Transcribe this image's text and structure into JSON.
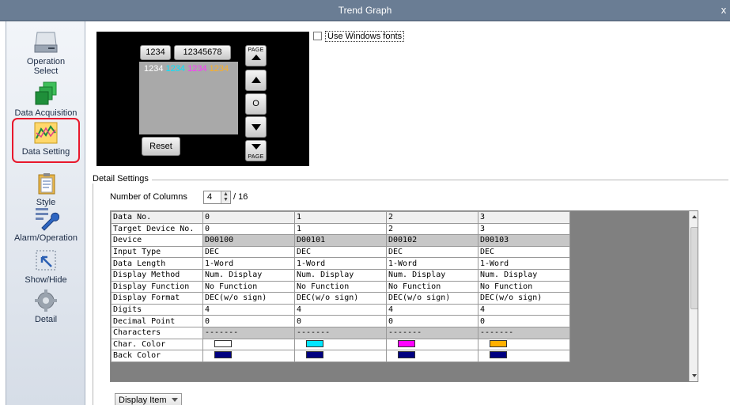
{
  "window": {
    "title": "Trend Graph",
    "close_glyph": "x"
  },
  "sidebar": {
    "items": [
      {
        "label": "Operation\nSelect",
        "icon": "operation-select-icon"
      },
      {
        "label": "Data Acquisition",
        "icon": "data-acquisition-icon"
      },
      {
        "label": "Data Setting",
        "icon": "data-setting-icon",
        "selected": true
      },
      {
        "label": "Style",
        "icon": "style-icon"
      },
      {
        "label": "Alarm/Operation",
        "icon": "alarm-operation-icon"
      },
      {
        "label": "Show/Hide",
        "icon": "show-hide-icon"
      },
      {
        "label": "Detail",
        "icon": "detail-icon"
      }
    ]
  },
  "preview": {
    "btn1": "1234",
    "btn2": "12345678",
    "reset": "Reset",
    "page_label": "PAGE",
    "center": "O",
    "values": [
      {
        "text": "1234",
        "color": "#ffffff"
      },
      {
        "text": "1234",
        "color": "#00e5ff"
      },
      {
        "text": "1234",
        "color": "#ff35ff"
      },
      {
        "text": "1234",
        "color": "#ffb020"
      }
    ]
  },
  "use_windows_fonts": {
    "label": "Use Windows fonts",
    "checked": false
  },
  "detail_settings": {
    "legend": "Detail Settings",
    "num_columns_label": "Number of Columns",
    "num_columns_value": "4",
    "num_columns_max": "/ 16"
  },
  "grid": {
    "columns": [
      "Data No.",
      "0",
      "1",
      "2",
      "3"
    ],
    "rows": [
      {
        "label": "Target Device No.",
        "values": [
          "0",
          "1",
          "2",
          "3"
        ]
      },
      {
        "label": "Device",
        "values": [
          "D00100",
          "D00101",
          "D00102",
          "D00103"
        ],
        "gray": true
      },
      {
        "label": "Input Type",
        "values": [
          "DEC",
          "DEC",
          "DEC",
          "DEC"
        ]
      },
      {
        "label": "Data Length",
        "values": [
          "1-Word",
          "1-Word",
          "1-Word",
          "1-Word"
        ]
      },
      {
        "label": "Display Method",
        "values": [
          "Num. Display",
          "Num. Display",
          "Num. Display",
          "Num. Display"
        ]
      },
      {
        "label": "Display Function",
        "values": [
          "No Function",
          "No Function",
          "No Function",
          "No Function"
        ]
      },
      {
        "label": "Display Format",
        "values": [
          "DEC(w/o sign)",
          "DEC(w/o sign)",
          "DEC(w/o sign)",
          "DEC(w/o sign)"
        ]
      },
      {
        "label": "Digits",
        "values": [
          "4",
          "4",
          "4",
          "4"
        ]
      },
      {
        "label": "Decimal Point",
        "values": [
          "0",
          "0",
          "0",
          "0"
        ]
      },
      {
        "label": "Characters",
        "values": [
          "-------",
          "-------",
          "-------",
          "-------"
        ],
        "gray": true
      }
    ],
    "char_color_label": "Char. Color",
    "char_colors": [
      "#ffffff",
      "#00e5ff",
      "#ff00ff",
      "#ffb000"
    ],
    "back_color_label": "Back Color",
    "back_colors": [
      "#000080",
      "#000080",
      "#000080",
      "#000080"
    ]
  },
  "display_item": {
    "label": "Display Item"
  }
}
